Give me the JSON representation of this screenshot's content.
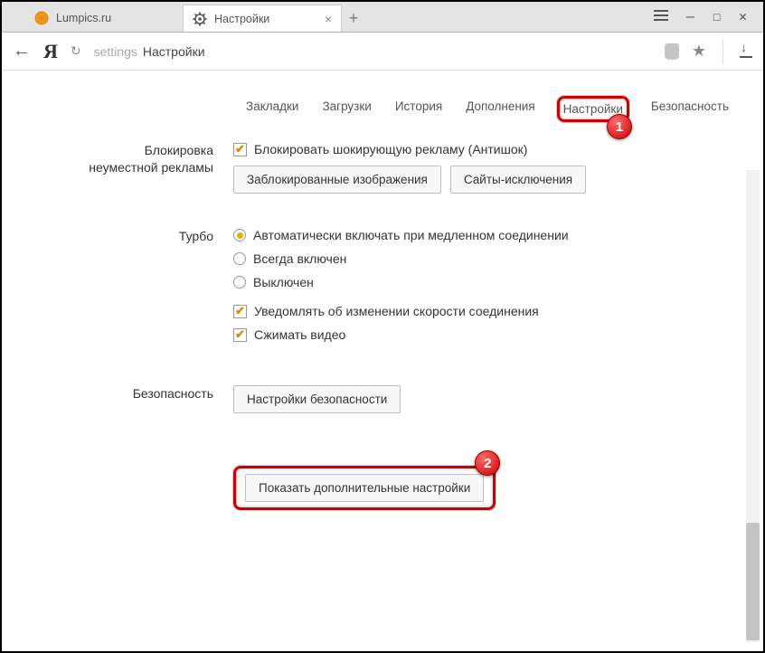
{
  "tabs": [
    {
      "title": "Lumpics.ru",
      "favicon": "orange"
    },
    {
      "title": "Настройки",
      "favicon": "gear"
    }
  ],
  "address": {
    "prefix": "settings",
    "title": "Настройки"
  },
  "nav": {
    "bookmarks": "Закладки",
    "downloads": "Загрузки",
    "history": "История",
    "addons": "Дополнения",
    "settings": "Настройки",
    "security": "Безопасность"
  },
  "ads": {
    "section_line1": "Блокировка",
    "section_line2": "неуместной рекламы",
    "block_shock": "Блокировать шокирующую рекламу (Антишок)",
    "blocked_images_btn": "Заблокированные изображения",
    "exceptions_btn": "Сайты-исключения"
  },
  "turbo": {
    "section": "Турбо",
    "auto": "Автоматически включать при медленном соединении",
    "always": "Всегда включен",
    "off": "Выключен",
    "notify": "Уведомлять об изменении скорости соединения",
    "compress": "Сжимать видео"
  },
  "security": {
    "section": "Безопасность",
    "settings_btn": "Настройки безопасности"
  },
  "advanced_btn": "Показать дополнительные настройки",
  "badges": {
    "one": "1",
    "two": "2"
  }
}
